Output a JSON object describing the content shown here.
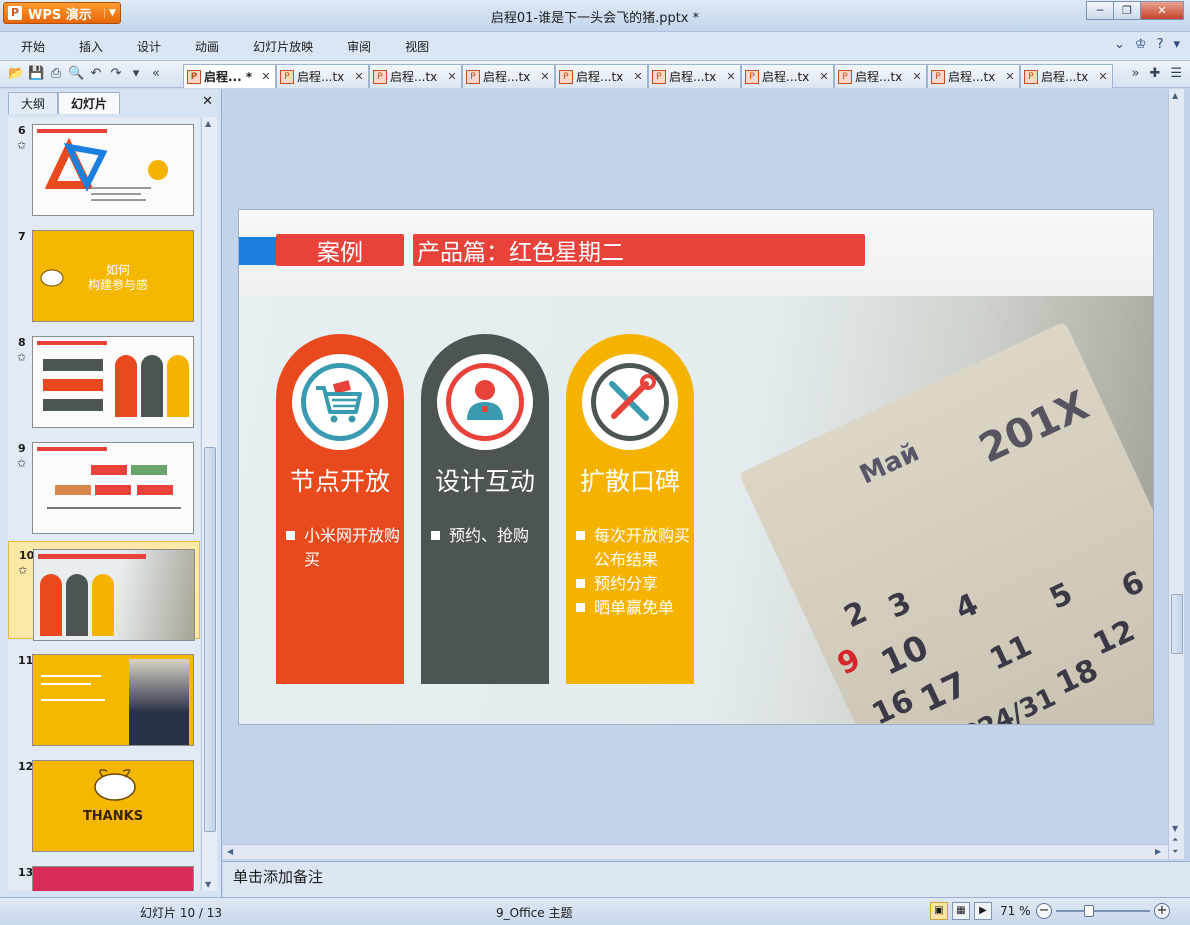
{
  "titlebar": {
    "app_name": "WPS 演示",
    "window_title": "启程01-谁是下一头会飞的猪.pptx *"
  },
  "menu": {
    "items": [
      "开始",
      "插入",
      "设计",
      "动画",
      "幻灯片放映",
      "审阅",
      "视图"
    ]
  },
  "doc_tabs": [
    {
      "label": "启程... *",
      "active": true
    },
    {
      "label": "启程...tx",
      "active": false
    },
    {
      "label": "启程...tx",
      "active": false
    },
    {
      "label": "启程...tx",
      "active": false
    },
    {
      "label": "启程...tx",
      "active": false
    },
    {
      "label": "启程...tx",
      "active": false
    },
    {
      "label": "启程...tx",
      "active": false
    },
    {
      "label": "启程...tx",
      "active": false
    },
    {
      "label": "启程...tx",
      "active": false
    },
    {
      "label": "启程...tx",
      "active": false
    }
  ],
  "left_panel": {
    "tabs": [
      "大纲",
      "幻灯片"
    ],
    "active_tab": "幻灯片",
    "thumbnails": [
      {
        "number": "6"
      },
      {
        "number": "7",
        "text_line1": "如何",
        "text_line2": "构建参与感"
      },
      {
        "number": "8"
      },
      {
        "number": "9"
      },
      {
        "number": "10",
        "selected": true
      },
      {
        "number": "11"
      },
      {
        "number": "12",
        "text": "THANKS"
      },
      {
        "number": "13"
      }
    ]
  },
  "slide": {
    "label_left": "案例",
    "label_right": "产品篇：红色星期二",
    "columns": [
      {
        "title": "节点开放",
        "bullets": [
          "小米网开放购买"
        ],
        "color": "#e8491d"
      },
      {
        "title": "设计互动",
        "bullets": [
          "预约、抢购"
        ],
        "color": "#4c5553"
      },
      {
        "title": "扩散口碑",
        "bullets": [
          "每次开放购买公布结果",
          "预约分享",
          "晒单赢免单"
        ],
        "color": "#f5b300"
      }
    ]
  },
  "notes": {
    "placeholder": "单击添加备注"
  },
  "statusbar": {
    "slide_position": "幻灯片 10 / 13",
    "theme": "9_Office 主题",
    "zoom": "71 %"
  },
  "colors": {
    "accent_red": "#e8423b",
    "accent_blue": "#1b7fde",
    "accent_yellow": "#f5b300"
  }
}
